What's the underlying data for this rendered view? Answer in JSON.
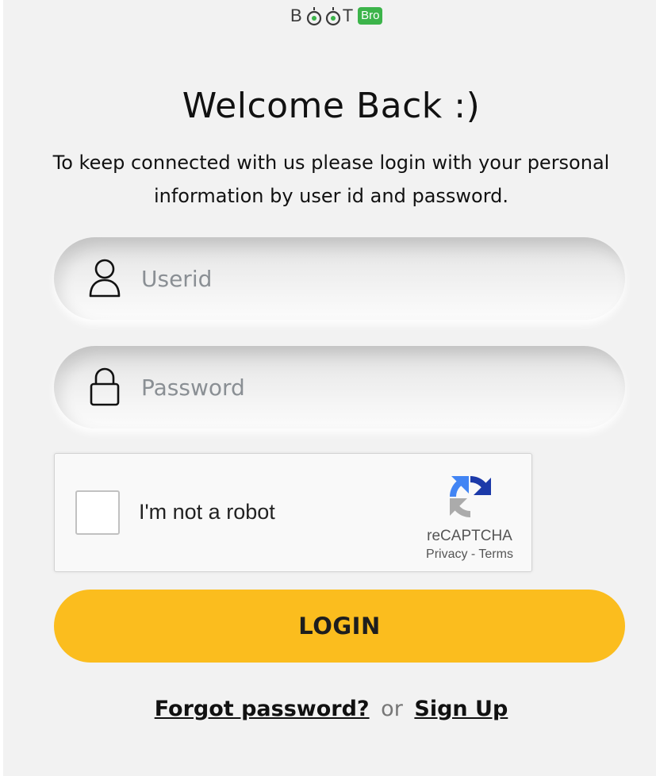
{
  "brand": {
    "logo_text_left": "B",
    "logo_text_right": "T",
    "logo_badge": "Bro",
    "badge_color": "#3cb44a"
  },
  "heading": {
    "title": "Welcome Back :)",
    "subtitle": "To keep connected with us please login with your personal information by user id and password."
  },
  "form": {
    "userid": {
      "placeholder": "Userid",
      "value": "",
      "icon": "user-icon"
    },
    "password": {
      "placeholder": "Password",
      "value": "",
      "icon": "lock-icon"
    }
  },
  "captcha": {
    "label": "I'm not a robot",
    "brand": "reCAPTCHA",
    "privacy": "Privacy",
    "separator": "-",
    "terms": "Terms",
    "checked": false
  },
  "actions": {
    "login_label": "LOGIN",
    "login_color": "#fbbd1e"
  },
  "footer": {
    "forgot_label": "Forgot password?",
    "or_text": "or",
    "signup_label": "Sign Up"
  }
}
